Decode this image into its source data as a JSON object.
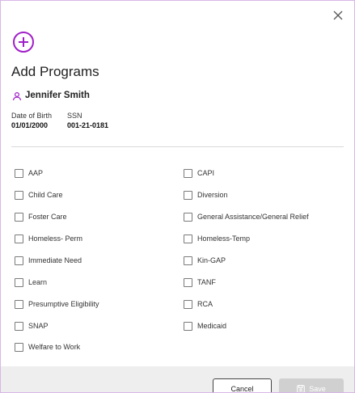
{
  "dialog": {
    "title": "Add Programs",
    "close_icon": "close-icon",
    "add_icon": "plus-circle-icon",
    "accent_color": "#a020c8"
  },
  "person": {
    "icon": "person-icon",
    "name": "Jennifer Smith",
    "dob_label": "Date of Birth",
    "dob_value": "01/01/2000",
    "ssn_label": "SSN",
    "ssn_value": "001-21-0181"
  },
  "programs": {
    "left": [
      "AAP",
      "Child Care",
      "Foster Care",
      "Homeless- Perm",
      "Immediate Need",
      "Learn",
      "Presumptive Eligibility",
      "SNAP",
      "Welfare to Work"
    ],
    "right": [
      "CAPI",
      "Diversion",
      "General Assistance/General Relief",
      "Homeless-Temp",
      "Kin-GAP",
      "TANF",
      "RCA",
      "Medicaid"
    ]
  },
  "footer": {
    "cancel_label": "Cancel",
    "save_label": "Save",
    "save_icon": "floppy-disk-icon"
  }
}
